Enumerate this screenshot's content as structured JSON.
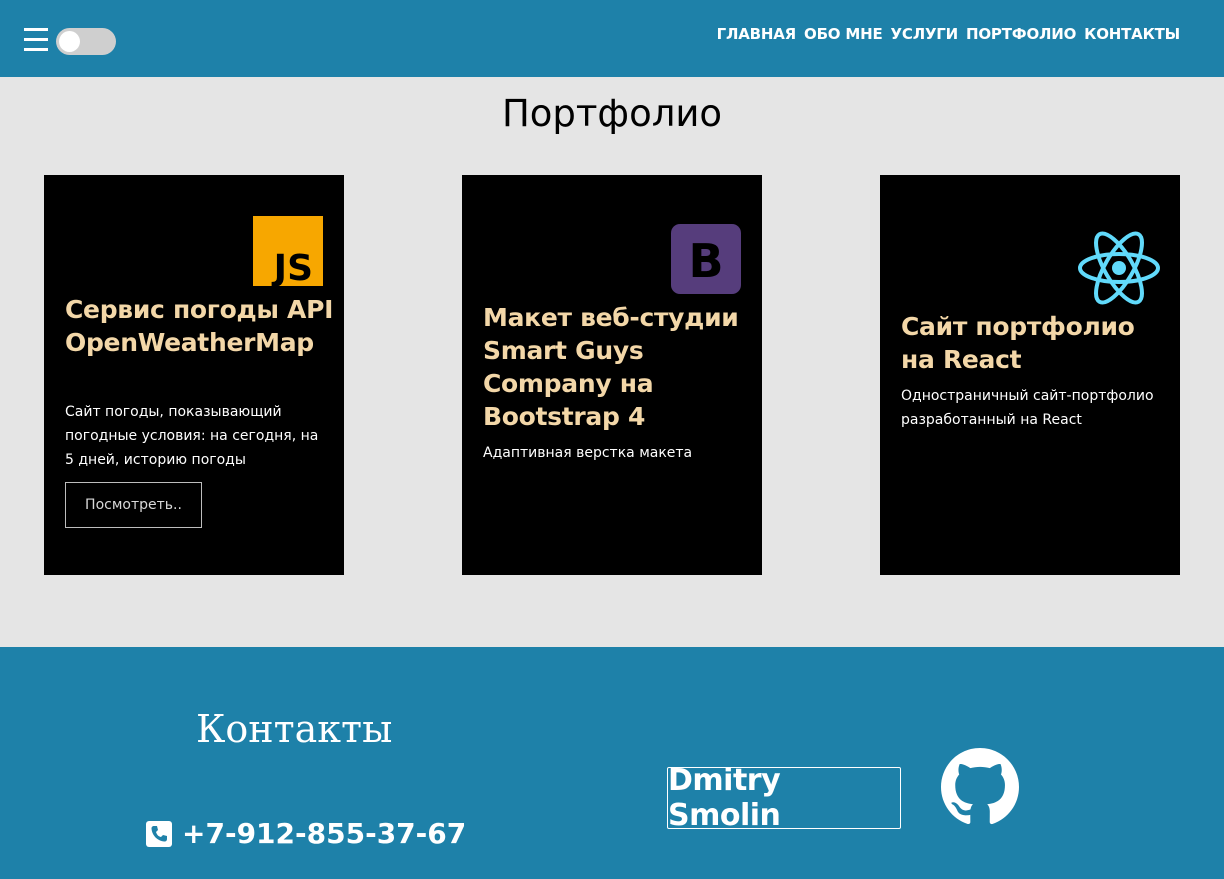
{
  "header": {
    "nav": [
      "ГЛАВНАЯ",
      "ОБО МНЕ",
      "УСЛУГИ",
      "ПОРТФОЛИО",
      "КОНТАКТЫ"
    ],
    "theme_toggle": "off"
  },
  "portfolio": {
    "title": "Портфолио",
    "cards": [
      {
        "logo": "javascript-logo",
        "logo_text": "JS",
        "title": "Сервис погоды API OpenWeatherMap",
        "description": "Сайт погоды, показывающий погодные условия: на сегодня, на 5 дней, историю погоды",
        "button": "Посмотреть.."
      },
      {
        "logo": "bootstrap-logo",
        "logo_text": "B",
        "title": "Макет веб-студии Smart Guys Company на Bootstrap 4",
        "description": "Адаптивная верстка макета"
      },
      {
        "logo": "react-logo",
        "title": "Сайт портфолио на React",
        "description": "Одностраничный сайт-портфолио разработанный на React"
      }
    ]
  },
  "footer": {
    "title": "Контакты",
    "phone": "+7-912-855-37-67",
    "name_button": "Dmitry Smolin",
    "github_icon": "github-icon"
  },
  "colors": {
    "header_bg": "#1e81a9",
    "page_bg": "#e5e5e5",
    "card_bg": "#000000",
    "card_title": "#f3d7a8",
    "js_yellow": "#f7a700",
    "bootstrap_purple": "#563d7c",
    "react_cyan": "#61dafb"
  }
}
